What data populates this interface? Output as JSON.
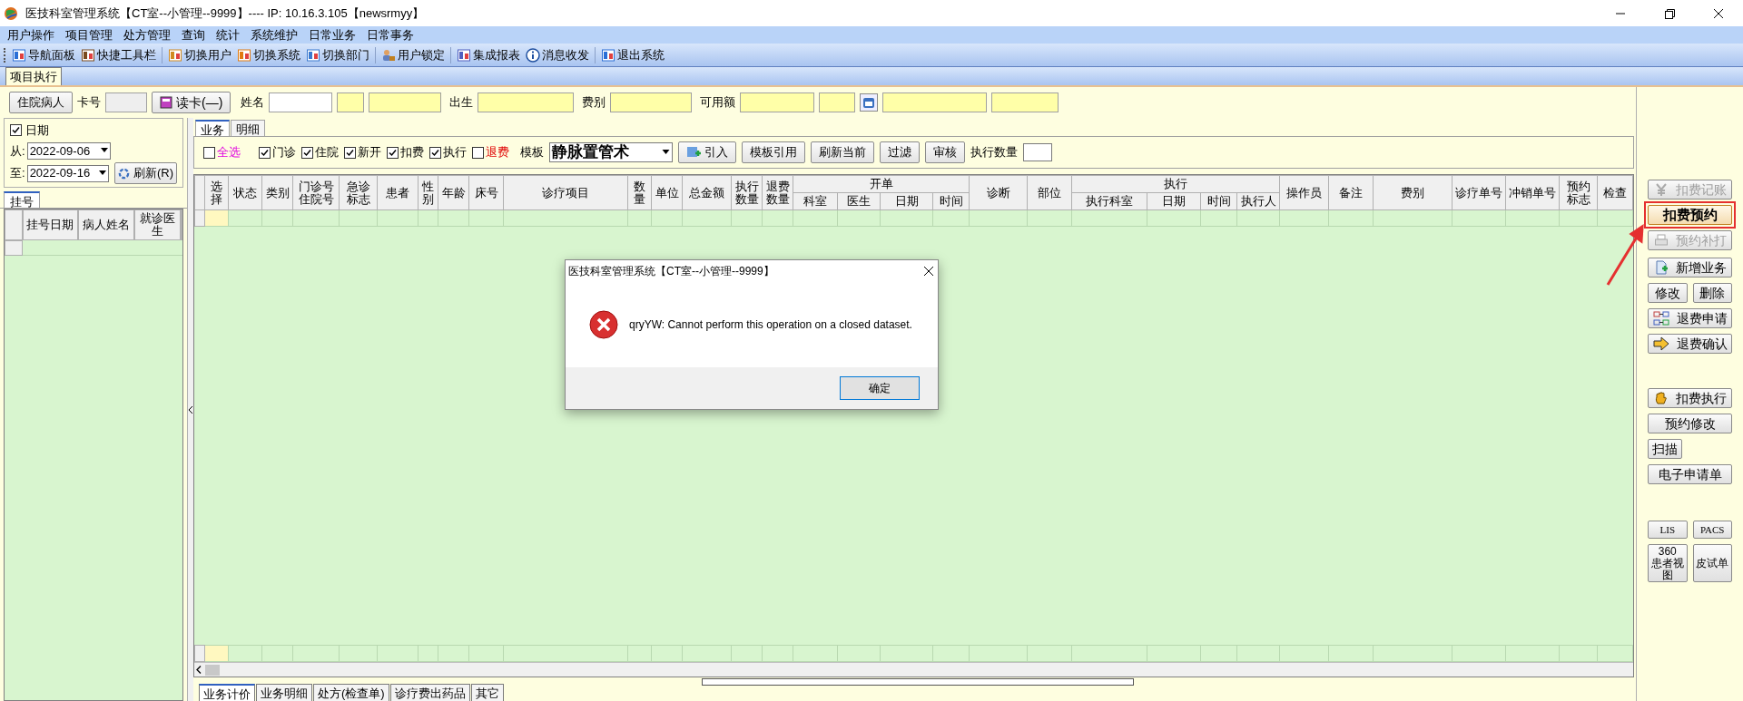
{
  "window": {
    "title": "医技科室管理系统【CT室--小管理--9999】---- IP:  10.16.3.105【newsrmyy】"
  },
  "menu": [
    "用户操作",
    "项目管理",
    "处方管理",
    "查询",
    "统计",
    "系统维护",
    "日常业务",
    "日常事务"
  ],
  "toolbar": [
    {
      "label": "导航面板"
    },
    {
      "label": "快捷工具栏"
    },
    {
      "label": "切换用户"
    },
    {
      "label": "切换系统"
    },
    {
      "label": "切换部门"
    },
    {
      "label": "用户锁定"
    },
    {
      "label": "集成报表"
    },
    {
      "label": "消息收发"
    },
    {
      "label": "退出系统"
    }
  ],
  "page_tabs": [
    {
      "label": "项目执行",
      "selected": true
    }
  ],
  "patient_bar": {
    "patient_type": "住院病人",
    "card_label": "卡号",
    "read_card": "读卡(—)",
    "name_label": "姓名",
    "birth_label": "出生",
    "fee_label": "费别",
    "balance_label": "可用额"
  },
  "left_panel": {
    "date_filter": {
      "label": "日期",
      "checked": true
    },
    "from_label": "从:",
    "from": "2022-09-06",
    "to_label": "至:",
    "to": "2022-09-16",
    "refresh": "刷新(R)",
    "tabs": [
      {
        "label": "挂号",
        "selected": true
      }
    ],
    "columns": [
      "挂号日期",
      "病人姓名",
      "就诊医生"
    ]
  },
  "sub_tabs": [
    {
      "label": "业务",
      "selected": true
    },
    {
      "label": "明细",
      "selected": false
    }
  ],
  "filters": [
    {
      "label": "全选",
      "checked": false,
      "kind": "select-all"
    },
    {
      "label": "门诊",
      "checked": true,
      "kind": "normal"
    },
    {
      "label": "住院",
      "checked": true,
      "kind": "normal"
    },
    {
      "label": "新开",
      "checked": true,
      "kind": "normal"
    },
    {
      "label": "扣费",
      "checked": true,
      "kind": "normal"
    },
    {
      "label": "执行",
      "checked": true,
      "kind": "normal"
    },
    {
      "label": "退费",
      "checked": false,
      "kind": "refund"
    }
  ],
  "template": {
    "label": "模板",
    "value": "静脉置管术"
  },
  "filter_buttons": [
    {
      "label": "引入",
      "kind": "import"
    },
    {
      "label": "模板引用",
      "kind": "plain"
    },
    {
      "label": "刷新当前",
      "kind": "plain"
    },
    {
      "label": "过滤",
      "kind": "plain"
    },
    {
      "label": "审核",
      "kind": "plain"
    }
  ],
  "exec_count_label": "执行数量",
  "table": {
    "columns": [
      {
        "label": "选择"
      },
      {
        "label": "状态"
      },
      {
        "label": "类别"
      },
      {
        "label": "门诊号住院号"
      },
      {
        "label": "急诊标志"
      },
      {
        "label": "患者"
      },
      {
        "label": "性别"
      },
      {
        "label": "年龄"
      },
      {
        "label": "床号"
      },
      {
        "label": "诊疗项目"
      },
      {
        "label": "数量"
      },
      {
        "label": "单位"
      },
      {
        "label": "总金额"
      },
      {
        "label": "执行数量"
      },
      {
        "label": "退费数量"
      },
      {
        "label": "开单",
        "children": [
          "科室",
          "医生",
          "日期",
          "时间"
        ]
      },
      {
        "label": "诊断"
      },
      {
        "label": "部位"
      },
      {
        "label": "执行",
        "children": [
          "执行科室",
          "日期",
          "时间",
          "执行人"
        ]
      },
      {
        "label": "操作员"
      },
      {
        "label": "备注"
      },
      {
        "label": "费别"
      },
      {
        "label": "诊疗单号"
      },
      {
        "label": "冲销单号"
      },
      {
        "label": "预约标志"
      },
      {
        "label": "检查"
      }
    ]
  },
  "bottom_tabs": [
    {
      "label": "业务计价",
      "selected": true
    },
    {
      "label": "业务明细",
      "selected": false
    },
    {
      "label": "处方(检查单)",
      "selected": false
    },
    {
      "label": "诊疗费出药品",
      "selected": false
    },
    {
      "label": "其它",
      "selected": false
    }
  ],
  "right_panel": {
    "groups": [
      [
        [
          {
            "label": "扣费记账",
            "kind": "charge",
            "disabled": true,
            "highlighted": false
          }
        ],
        [
          {
            "label": "扣费预约",
            "kind": "plain",
            "disabled": false,
            "highlighted": true
          }
        ],
        [
          {
            "label": "预约补打",
            "kind": "print",
            "disabled": true,
            "highlighted": false
          }
        ]
      ],
      [
        [
          {
            "label": "新增业务",
            "kind": "add",
            "disabled": false,
            "highlighted": false
          }
        ],
        [
          {
            "label": "修改",
            "kind": "plain",
            "disabled": false,
            "highlighted": false
          },
          {
            "label": "删除",
            "kind": "plain",
            "disabled": false,
            "highlighted": false
          }
        ]
      ],
      [
        [
          {
            "label": "退费申请",
            "kind": "refund-request",
            "disabled": false,
            "highlighted": false
          }
        ],
        [
          {
            "label": "退费确认",
            "kind": "refund-confirm",
            "disabled": false,
            "highlighted": false
          }
        ]
      ],
      [
        [
          {
            "label": "扣费执行",
            "kind": "execute",
            "disabled": false,
            "highlighted": false
          }
        ],
        [
          {
            "label": "预约修改",
            "kind": "plain",
            "disabled": false,
            "highlighted": false
          }
        ],
        [
          {
            "label": "扫描",
            "kind": "small",
            "disabled": false,
            "highlighted": false
          }
        ],
        [
          {
            "label": "电子申请单",
            "kind": "plain",
            "disabled": false,
            "highlighted": false
          }
        ]
      ],
      [
        [
          {
            "label": "LIS",
            "kind": "mono",
            "disabled": false,
            "highlighted": false
          },
          {
            "label": "PACS",
            "kind": "mono",
            "disabled": false,
            "highlighted": false
          }
        ],
        [
          {
            "label": "360患者视图",
            "kind": "tall",
            "disabled": false,
            "highlighted": false
          },
          {
            "label": "皮试单",
            "kind": "tall",
            "disabled": false,
            "highlighted": false
          }
        ]
      ]
    ]
  },
  "dialog": {
    "title": "医技科室管理系统【CT室--小管理--9999】",
    "message": "qryYW: Cannot perform this operation on a closed dataset.",
    "button": "确定"
  }
}
